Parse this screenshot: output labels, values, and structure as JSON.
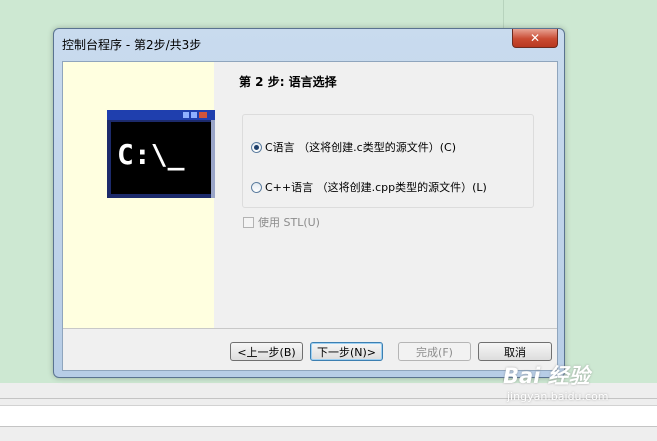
{
  "window": {
    "title": "控制台程序 - 第2步/共3步",
    "close_label": "✕"
  },
  "wizard": {
    "step_title": "第 2 步: 语言选择",
    "options": [
      {
        "label": "C语言 （这将创建.c类型的源文件）(C)",
        "checked": true
      },
      {
        "label": "C++语言 （这将创建.cpp类型的源文件）(L)",
        "checked": false
      }
    ],
    "use_stl_label": "使用 STL(U)",
    "use_stl_checked": false,
    "use_stl_enabled": false
  },
  "buttons": {
    "back": "<上一步(B)",
    "next": "下一步(N)>",
    "finish": "完成(F)",
    "cancel": "取消"
  },
  "console_icon": {
    "prompt_text": "C:\\_"
  },
  "watermark": {
    "main": "Bai 经验",
    "sub": "jingyan.baidu.com"
  }
}
